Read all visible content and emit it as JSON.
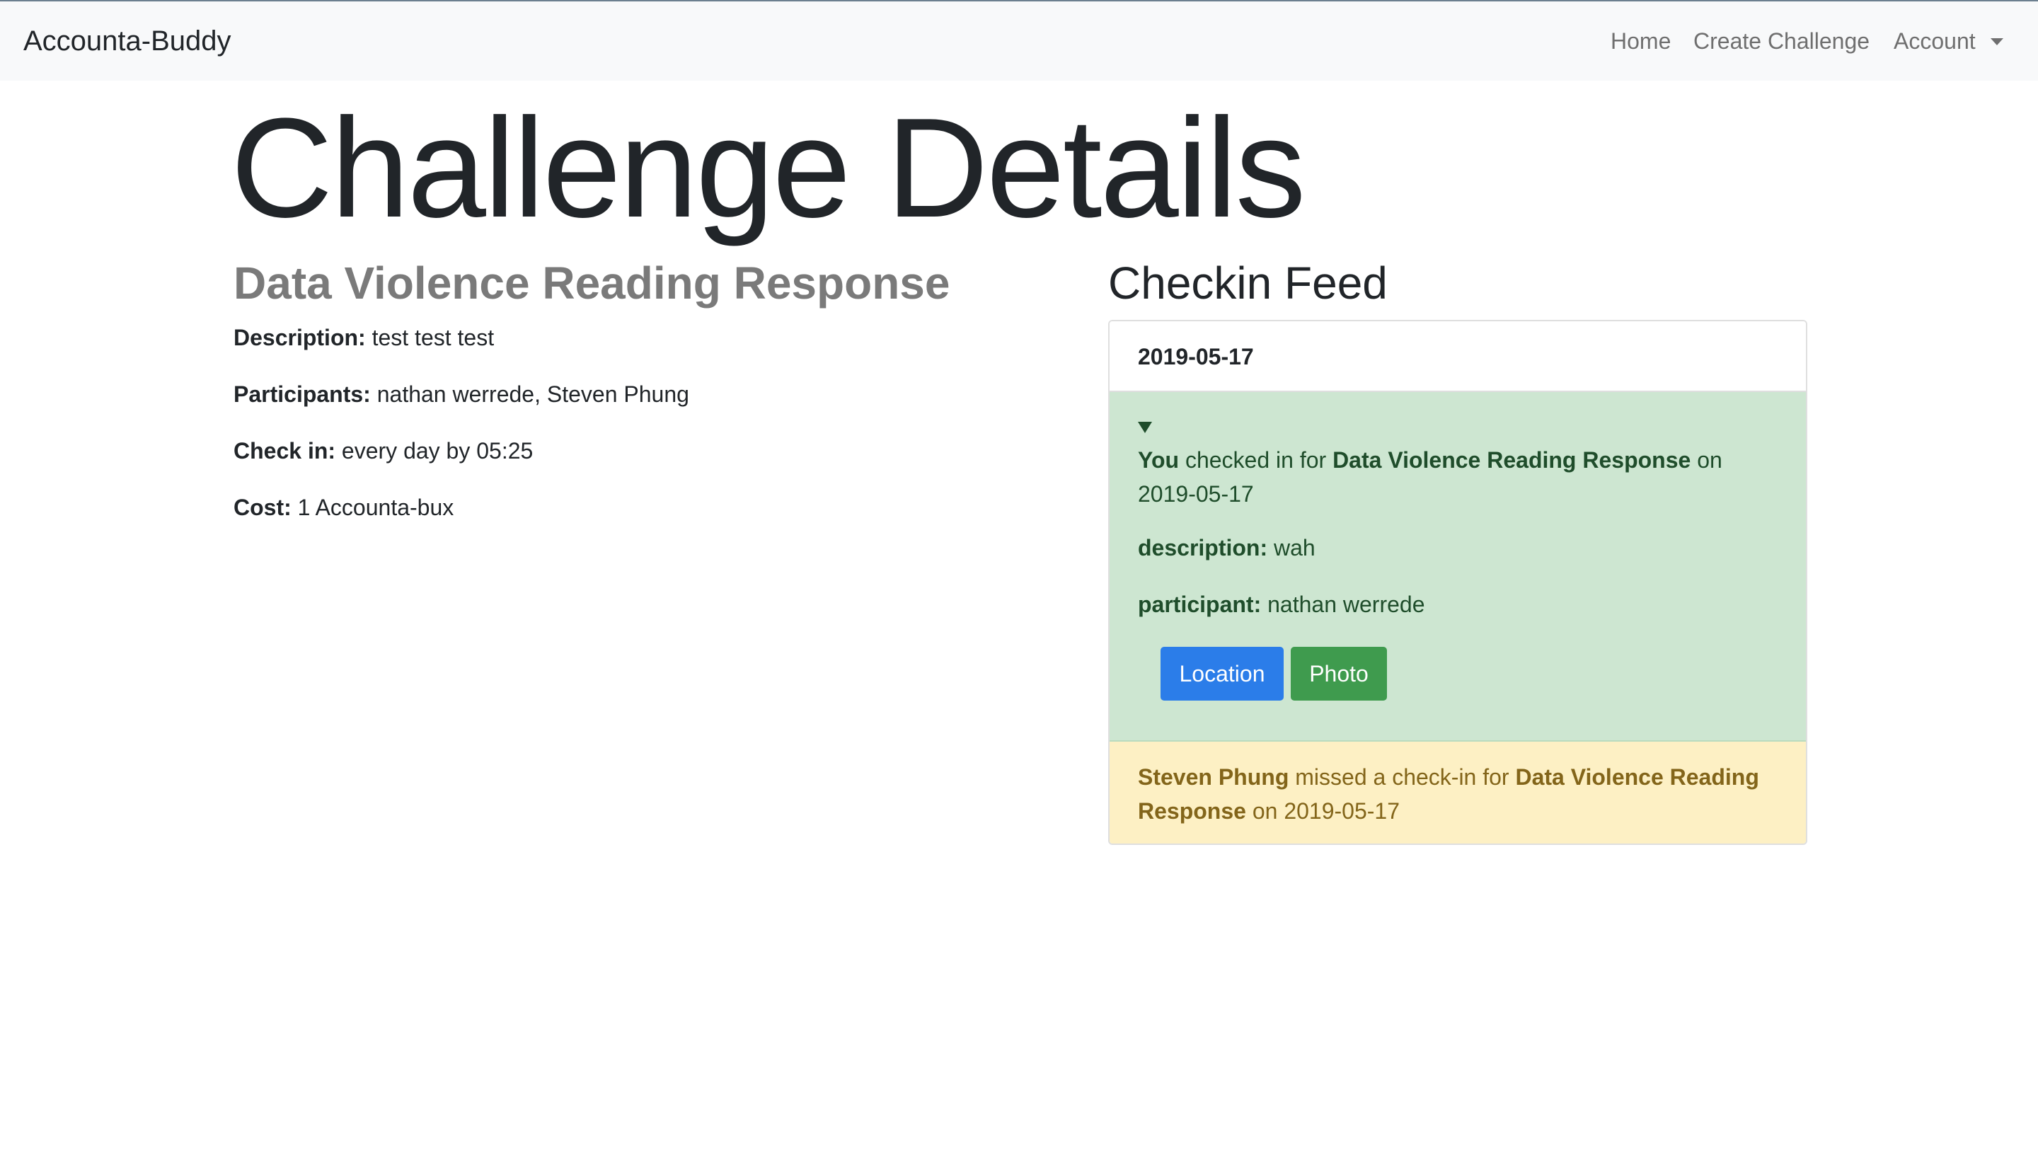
{
  "navbar": {
    "brand": "Accounta-Buddy",
    "links": [
      {
        "label": "Home"
      },
      {
        "label": "Create Challenge"
      },
      {
        "label": "Account"
      }
    ]
  },
  "page": {
    "title": "Challenge Details"
  },
  "challenge": {
    "name": "Data Violence Reading Response",
    "details": [
      {
        "label": "Description:",
        "value": "test test test"
      },
      {
        "label": "Participants:",
        "value": "nathan werrede, Steven Phung"
      },
      {
        "label": "Check in:",
        "value": "every day by 05:25"
      },
      {
        "label": "Cost:",
        "value": "1 Accounta-bux"
      }
    ]
  },
  "feed": {
    "title": "Checkin Feed",
    "date": "2019-05-17",
    "checkin": {
      "actor": "You",
      "action": " checked in for ",
      "challenge": "Data Violence Reading Response",
      "connector": " on ",
      "date": "2019-05-17",
      "description_label": "description:",
      "description_value": "wah",
      "participant_label": "participant:",
      "participant_value": "nathan werrede",
      "location_button": "Location",
      "photo_button": "Photo"
    },
    "missed": {
      "actor": "Steven Phung",
      "action": " missed a check-in for ",
      "challenge": "Data Violence Reading Response",
      "connector": " on ",
      "date": "2019-05-17"
    }
  },
  "colors": {
    "success_bg": "#cde6d1",
    "warning_bg": "#fdf0c4",
    "primary_button": "#2b7de9",
    "success_button": "#3f9b4e"
  },
  "icons": {
    "expand": "triangle-down-icon",
    "dropdown": "chevron-down-icon"
  }
}
